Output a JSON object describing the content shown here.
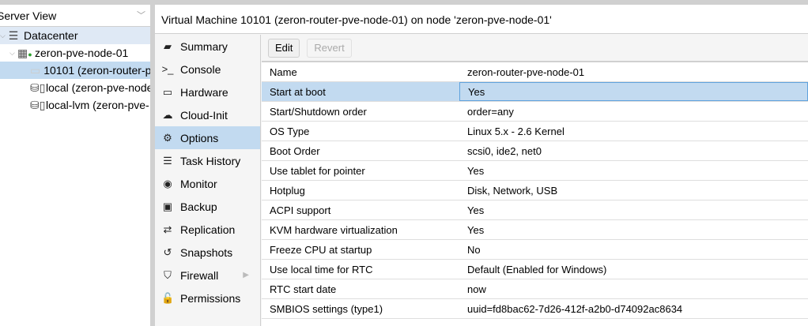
{
  "view_selector": "Server View",
  "tree": [
    {
      "label": "Datacenter",
      "icon": "server-rack-icon"
    },
    {
      "label": "zeron-pve-node-01",
      "icon": "node-online-icon"
    },
    {
      "label": "10101 (zeron-router-p",
      "icon": "vm-monitor-icon"
    },
    {
      "label": "local (zeron-pve-node",
      "icon": "storage-icon"
    },
    {
      "label": "local-lvm (zeron-pve-",
      "icon": "storage-icon"
    }
  ],
  "header": {
    "title": "Virtual Machine 10101 (zeron-router-pve-node-01) on node 'zeron-pve-node-01'"
  },
  "nav": [
    {
      "label": "Summary",
      "icon": "book-icon",
      "glyph": "▰"
    },
    {
      "label": "Console",
      "icon": "terminal-icon",
      "glyph": ">_"
    },
    {
      "label": "Hardware",
      "icon": "monitor-icon",
      "glyph": "▭"
    },
    {
      "label": "Cloud-Init",
      "icon": "cloud-icon",
      "glyph": "☁"
    },
    {
      "label": "Options",
      "icon": "gear-icon",
      "glyph": "⚙"
    },
    {
      "label": "Task History",
      "icon": "list-icon",
      "glyph": "☰"
    },
    {
      "label": "Monitor",
      "icon": "eye-icon",
      "glyph": "◉"
    },
    {
      "label": "Backup",
      "icon": "floppy-icon",
      "glyph": "▣"
    },
    {
      "label": "Replication",
      "icon": "retweet-icon",
      "glyph": "⇄"
    },
    {
      "label": "Snapshots",
      "icon": "history-icon",
      "glyph": "↺"
    },
    {
      "label": "Firewall",
      "icon": "shield-icon",
      "glyph": "⛉"
    },
    {
      "label": "Permissions",
      "icon": "unlock-icon",
      "glyph": "🔓"
    }
  ],
  "toolbar": {
    "edit": "Edit",
    "revert": "Revert"
  },
  "options": [
    {
      "k": "Name",
      "v": "zeron-router-pve-node-01"
    },
    {
      "k": "Start at boot",
      "v": "Yes"
    },
    {
      "k": "Start/Shutdown order",
      "v": "order=any"
    },
    {
      "k": "OS Type",
      "v": "Linux 5.x - 2.6 Kernel"
    },
    {
      "k": "Boot Order",
      "v": "scsi0, ide2, net0"
    },
    {
      "k": "Use tablet for pointer",
      "v": "Yes"
    },
    {
      "k": "Hotplug",
      "v": "Disk, Network, USB"
    },
    {
      "k": "ACPI support",
      "v": "Yes"
    },
    {
      "k": "KVM hardware virtualization",
      "v": "Yes"
    },
    {
      "k": "Freeze CPU at startup",
      "v": "No"
    },
    {
      "k": "Use local time for RTC",
      "v": "Default (Enabled for Windows)"
    },
    {
      "k": "RTC start date",
      "v": "now"
    },
    {
      "k": "SMBIOS settings (type1)",
      "v": "uuid=fd8bac62-7d26-412f-a2b0-d74092ac8634"
    }
  ]
}
